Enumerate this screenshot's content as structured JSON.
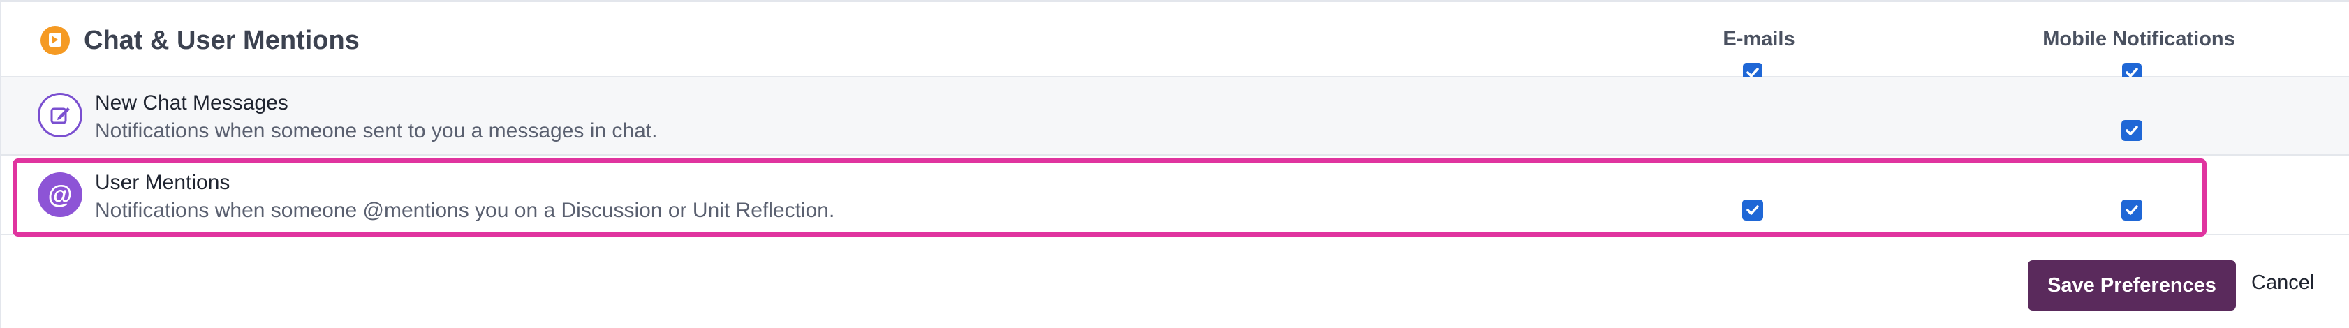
{
  "section": {
    "title": "Chat & User Mentions",
    "icon": "chat-logo-icon",
    "brand_color": "#f59a23"
  },
  "columns": {
    "email": "E-mails",
    "mobile": "Mobile Notifications"
  },
  "header_checks": {
    "email": true,
    "mobile": true
  },
  "rows": [
    {
      "title": "New Chat Messages",
      "description": "Notifications when someone sent to you a messages in chat.",
      "icon": "edit-icon",
      "email": false,
      "mobile": true
    },
    {
      "title": "User Mentions",
      "description": "Notifications when someone @mentions you on a Discussion or Unit Reflection.",
      "icon_text": "@",
      "icon": "at-icon",
      "email": true,
      "mobile": true
    }
  ],
  "actions": {
    "save_label": "Save Preferences",
    "cancel_label": "Cancel"
  },
  "colors": {
    "accent": "#1f67d6",
    "save_button": "#5a2a5c",
    "highlight": "#e0349f",
    "icon_purple": "#8d54d6"
  }
}
